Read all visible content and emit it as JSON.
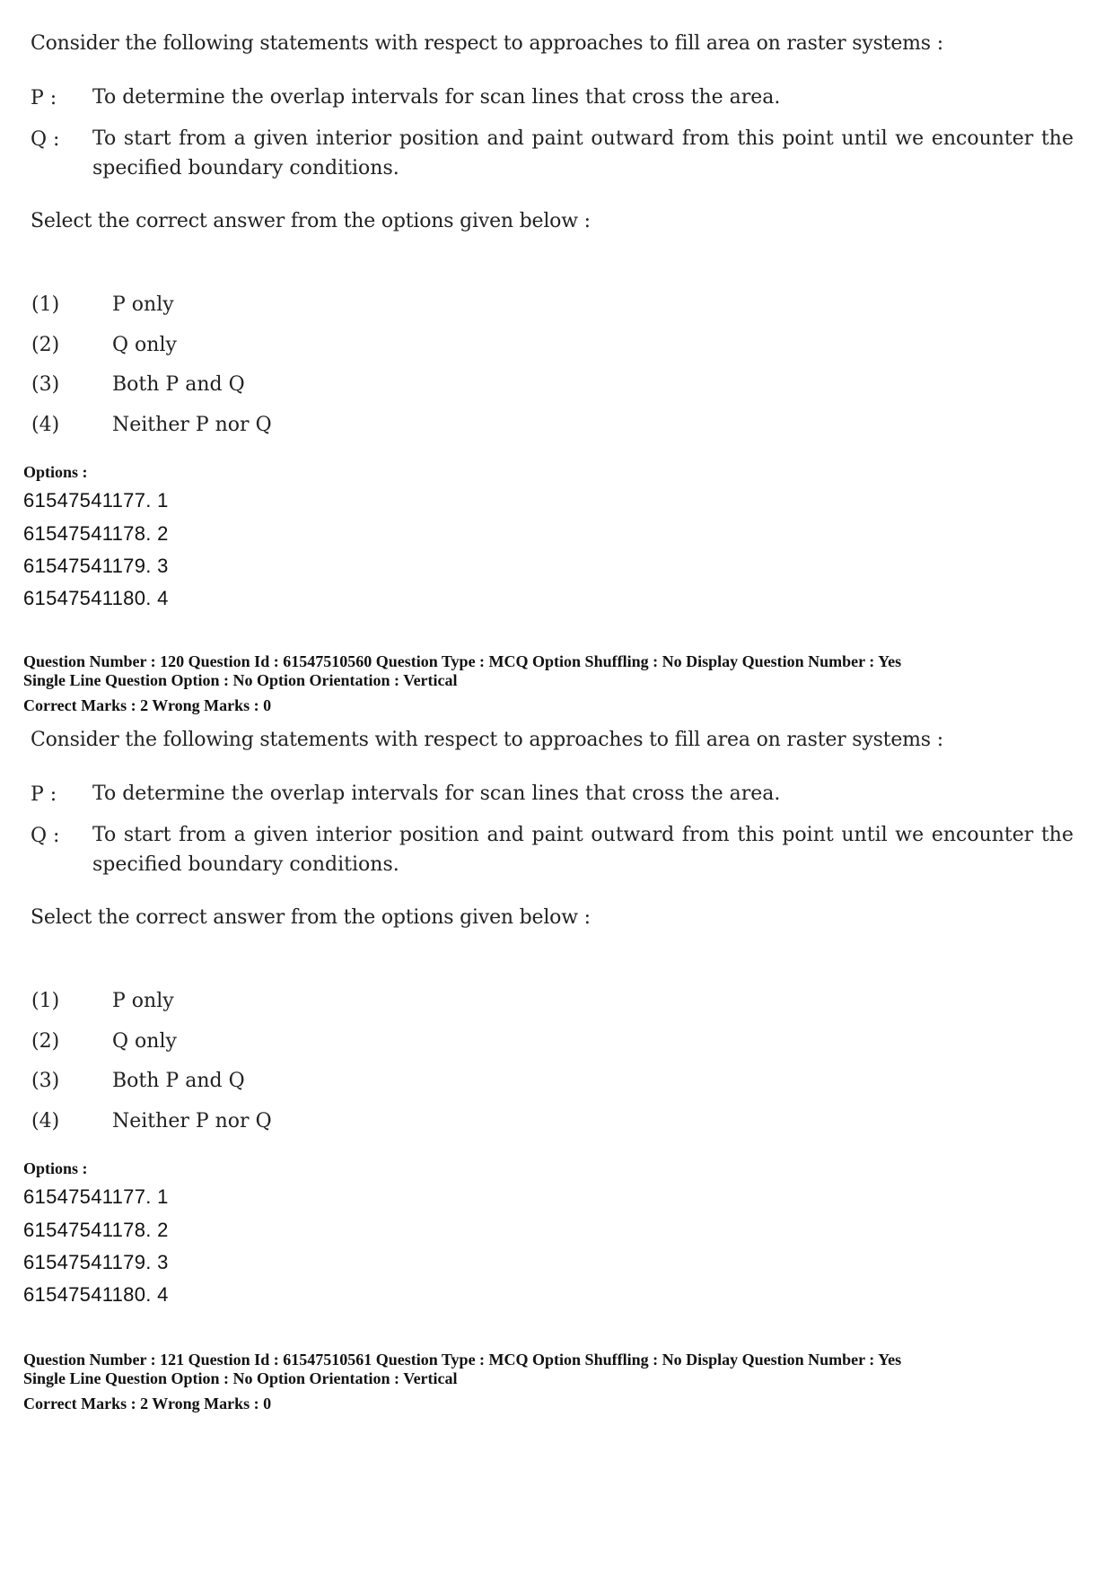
{
  "question_blocks": [
    {
      "stem": "Consider the following statements with respect to approaches to fill area on raster systems :",
      "statements": [
        {
          "label": "P :",
          "text": "To determine the overlap intervals for scan lines that cross the area."
        },
        {
          "label": "Q :",
          "text": "To start from a given interior position and paint outward from this point until we encounter the specified boundary conditions."
        }
      ],
      "instruction": "Select the correct answer from the options given below :",
      "choices": [
        {
          "num": "(1)",
          "text": "P only"
        },
        {
          "num": "(2)",
          "text": "Q only"
        },
        {
          "num": "(3)",
          "text": "Both P and Q"
        },
        {
          "num": "(4)",
          "text": "Neither P nor Q"
        }
      ],
      "options_heading": "Options :",
      "options": [
        "61547541177. 1",
        "61547541178. 2",
        "61547541179. 3",
        "61547541180. 4"
      ]
    },
    {
      "stem": "Consider the following statements with respect to approaches to fill area on raster systems :",
      "statements": [
        {
          "label": "P :",
          "text": "To determine the overlap intervals for scan lines that cross the area."
        },
        {
          "label": "Q :",
          "text": "To start from a given interior position and paint outward from this point until we encounter the specified boundary conditions."
        }
      ],
      "instruction": "Select the correct answer from the options given below :",
      "choices": [
        {
          "num": "(1)",
          "text": "P only"
        },
        {
          "num": "(2)",
          "text": "Q only"
        },
        {
          "num": "(3)",
          "text": "Both P and Q"
        },
        {
          "num": "(4)",
          "text": "Neither P nor Q"
        }
      ],
      "options_heading": "Options :",
      "options": [
        "61547541177. 1",
        "61547541178. 2",
        "61547541179. 3",
        "61547541180. 4"
      ]
    }
  ],
  "meta_blocks": [
    {
      "line1": "Question Number : 120  Question Id : 61547510560  Question Type : MCQ  Option Shuffling : No  Display Question Number : Yes",
      "line2": "Single Line Question Option : No  Option Orientation : Vertical",
      "line3": "Correct Marks : 2  Wrong Marks : 0"
    },
    {
      "line1": "Question Number : 121  Question Id : 61547510561  Question Type : MCQ  Option Shuffling : No  Display Question Number : Yes",
      "line2": "Single Line Question Option : No  Option Orientation : Vertical",
      "line3": "Correct Marks : 2  Wrong Marks : 0"
    }
  ]
}
